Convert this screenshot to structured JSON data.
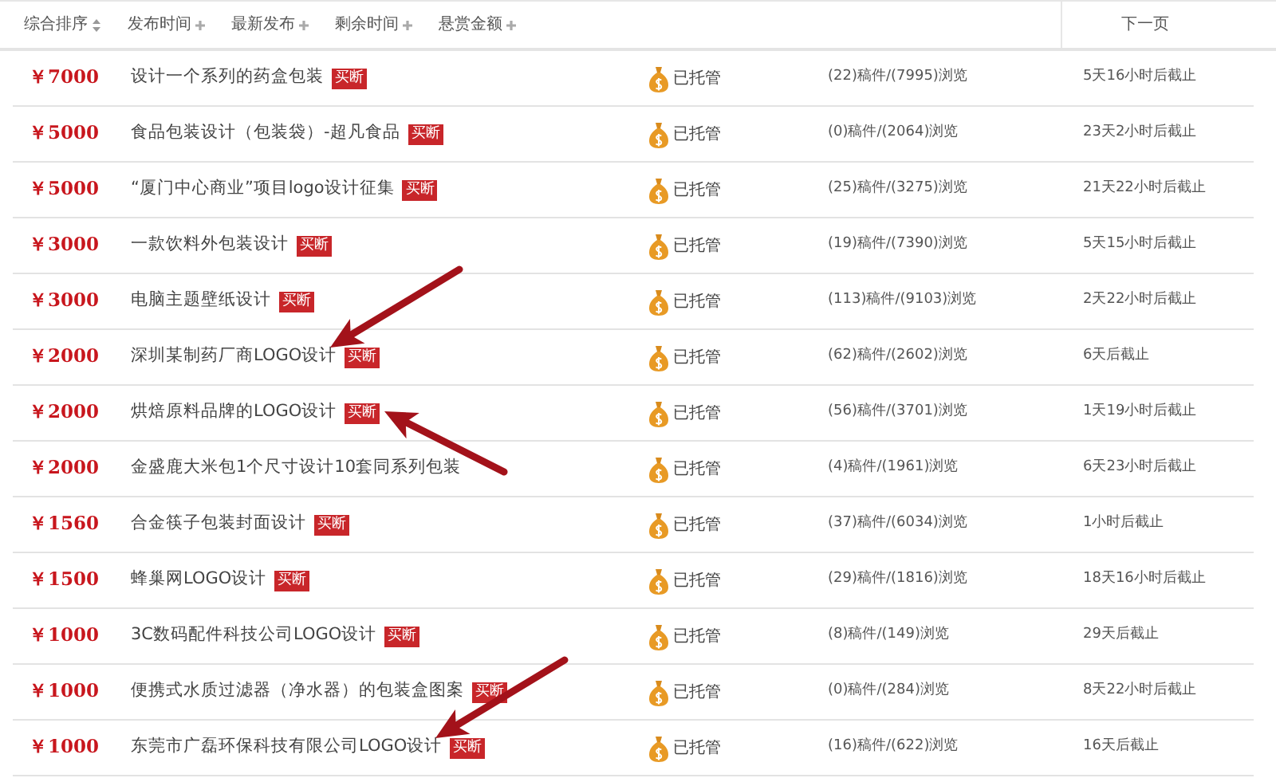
{
  "sort_bar": {
    "options": [
      {
        "label": "综合排序",
        "kind": "updown"
      },
      {
        "label": "发布时间",
        "kind": "down"
      },
      {
        "label": "最新发布",
        "kind": "down"
      },
      {
        "label": "剩余时间",
        "kind": "down"
      },
      {
        "label": "悬赏金额",
        "kind": "down"
      }
    ],
    "next_page": "下一页"
  },
  "tasks": [
    {
      "price": "￥7000",
      "title": "设计一个系列的药盒包装",
      "tag": "买断",
      "escrow": "已托管",
      "stats": "(22)稿件/(7995)浏览",
      "deadline": "5天16小时后截止"
    },
    {
      "price": "￥5000",
      "title": "食品包装设计（包装袋）-超凡食品",
      "tag": "买断",
      "escrow": "已托管",
      "stats": "(0)稿件/(2064)浏览",
      "deadline": "23天2小时后截止"
    },
    {
      "price": "￥5000",
      "title": "“厦门中心商业”项目logo设计征集",
      "tag": "买断",
      "escrow": "已托管",
      "stats": "(25)稿件/(3275)浏览",
      "deadline": "21天22小时后截止"
    },
    {
      "price": "￥3000",
      "title": "一款饮料外包装设计",
      "tag": "买断",
      "escrow": "已托管",
      "stats": "(19)稿件/(7390)浏览",
      "deadline": "5天15小时后截止"
    },
    {
      "price": "￥3000",
      "title": "电脑主题壁纸设计",
      "tag": "买断",
      "escrow": "已托管",
      "stats": "(113)稿件/(9103)浏览",
      "deadline": "2天22小时后截止"
    },
    {
      "price": "￥2000",
      "title": "深圳某制药厂商LOGO设计",
      "tag": "买断",
      "escrow": "已托管",
      "stats": "(62)稿件/(2602)浏览",
      "deadline": "6天后截止",
      "arrow": true,
      "arrow_from_below": false
    },
    {
      "price": "￥2000",
      "title": "烘焙原料品牌的LOGO设计",
      "tag": "买断",
      "escrow": "已托管",
      "stats": "(56)稿件/(3701)浏览",
      "deadline": "1天19小时后截止",
      "arrow": true,
      "arrow_from_below": true
    },
    {
      "price": "￥2000",
      "title": "金盛鹿大米包1个尺寸设计10套同系列包装",
      "escrow": "已托管",
      "stats": "(4)稿件/(1961)浏览",
      "deadline": "6天23小时后截止"
    },
    {
      "price": "￥1560",
      "title": "合金筷子包装封面设计",
      "tag": "买断",
      "escrow": "已托管",
      "stats": "(37)稿件/(6034)浏览",
      "deadline": "1小时后截止"
    },
    {
      "price": "￥1500",
      "title": "蜂巢网LOGO设计",
      "tag": "买断",
      "escrow": "已托管",
      "stats": "(29)稿件/(1816)浏览",
      "deadline": "18天16小时后截止"
    },
    {
      "price": "￥1000",
      "title": "3C数码配件科技公司LOGO设计",
      "tag": "买断",
      "escrow": "已托管",
      "stats": "(8)稿件/(149)浏览",
      "deadline": "29天后截止"
    },
    {
      "price": "￥1000",
      "title": "便携式水质过滤器（净水器）的包装盒图案",
      "tag": "买断",
      "escrow": "已托管",
      "stats": "(0)稿件/(284)浏览",
      "deadline": "8天22小时后截止"
    },
    {
      "price": "￥1000",
      "title": "东莞市广磊环保科技有限公司LOGO设计",
      "tag": "买断",
      "escrow": "已托管",
      "stats": "(16)稿件/(622)浏览",
      "deadline": "16天后截止",
      "arrow": true,
      "arrow_from_below": false
    }
  ]
}
